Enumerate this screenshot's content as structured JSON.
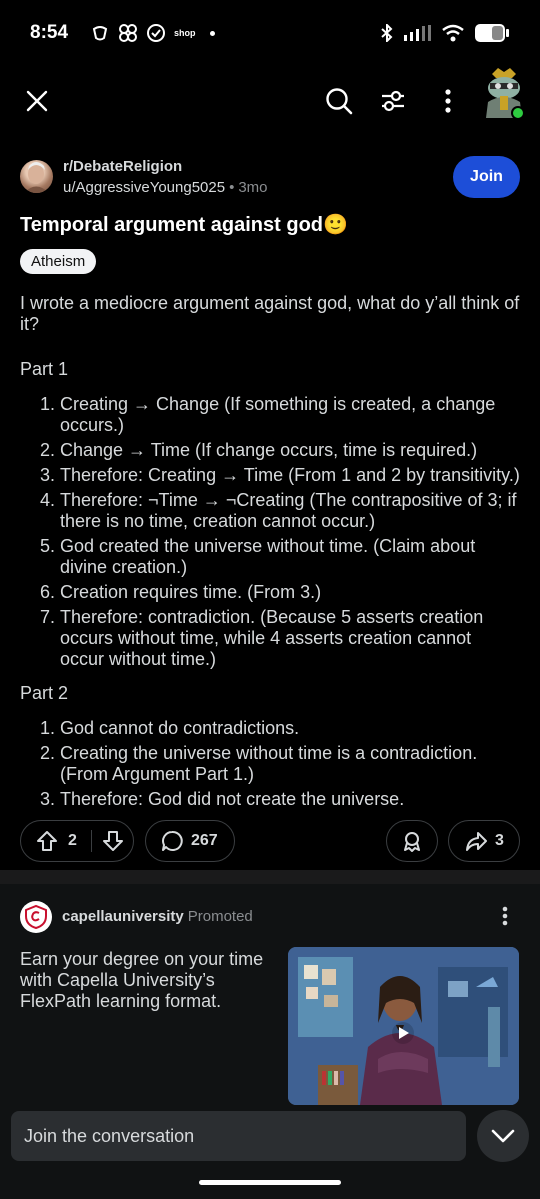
{
  "status": {
    "time": "8:54",
    "shop_label": "shop"
  },
  "post": {
    "subreddit": "r/DebateReligion",
    "author": "u/AggressiveYoung5025",
    "separator": "•",
    "age": "3mo",
    "join_label": "Join",
    "title": "Temporal argument against god🙂",
    "flair": "Atheism",
    "intro": "I wrote a mediocre argument against god, what do y’all think of it?",
    "part1_heading": "Part 1",
    "part1_items": [
      {
        "num": "1.",
        "text": "Creating → Change (If something is created, a change occurs.)"
      },
      {
        "num": "2.",
        "text": "Change → Time (If change occurs, time is required.)"
      },
      {
        "num": "3.",
        "text": "Therefore: Creating → Time (From 1 and 2 by transitivity.)"
      },
      {
        "num": "4.",
        "text": "Therefore: ¬Time → ¬Creating (The contrapositive of 3; if there is no time, creation cannot occur.)"
      },
      {
        "num": "5.",
        "text": "God created the universe without time. (Claim about divine creation.)"
      },
      {
        "num": "6.",
        "text": "Creation requires time. (From 3.)"
      },
      {
        "num": "7.",
        "text": "Therefore: contradiction. (Because 5 asserts creation occurs without time, while 4 asserts creation cannot occur without time.)"
      }
    ],
    "part2_heading": "Part 2",
    "part2_items": [
      {
        "num": "1.",
        "text": "God cannot do contradictions."
      },
      {
        "num": "2.",
        "text": "Creating the universe without time is a contradiction. (From Argument Part 1.)"
      },
      {
        "num": "3.",
        "text": "Therefore: God did not create the universe."
      }
    ],
    "votes": "2",
    "comments": "267",
    "shares": "3"
  },
  "ad": {
    "advertiser": "capellauniversity",
    "promoted_label": "Promoted",
    "text": "Earn your degree on your time with Capella University’s FlexPath learning format."
  },
  "composer": {
    "placeholder": "Join the conversation"
  },
  "colors": {
    "background": "#000000",
    "join_button": "#1d4ed8",
    "ad_background": "#101213"
  }
}
